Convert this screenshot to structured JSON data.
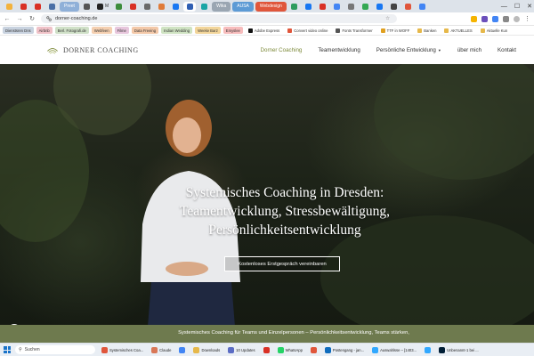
{
  "browser": {
    "tabs": [
      {
        "label": "",
        "color": "#f3b23c"
      },
      {
        "label": "",
        "color": "#d93025"
      },
      {
        "label": "",
        "color": "#d93025"
      },
      {
        "label": "",
        "color": "#4a6fa5"
      },
      {
        "label": "Preet",
        "color": "#8fb0d8",
        "pill": true
      },
      {
        "label": "",
        "color": "#555555"
      },
      {
        "label": "M",
        "color": "#222222"
      },
      {
        "label": "",
        "color": "#3b8c3b"
      },
      {
        "label": "",
        "color": "#d93025"
      },
      {
        "label": "",
        "color": "#6a6a6a"
      },
      {
        "label": "",
        "color": "#e07b39"
      },
      {
        "label": "",
        "color": "#1877f2"
      },
      {
        "label": "",
        "color": "#2f5fb3",
        "active": true
      },
      {
        "label": "",
        "color": "#1aa5a5"
      },
      {
        "label": "Wika",
        "color": "#9aa6b2",
        "pill": true
      },
      {
        "label": "AUSA",
        "color": "#5d9bd5",
        "pill": true
      },
      {
        "label": "Webdesign",
        "color": "#e0563b",
        "pill": true
      },
      {
        "label": "",
        "color": "#2e9c5e"
      },
      {
        "label": "",
        "color": "#1877f2"
      },
      {
        "label": "",
        "color": "#d93025"
      },
      {
        "label": "",
        "color": "#4285f4"
      },
      {
        "label": "",
        "color": "#777777"
      },
      {
        "label": "",
        "color": "#34a853"
      },
      {
        "label": "",
        "color": "#1877f2"
      },
      {
        "label": "",
        "color": "#444444"
      },
      {
        "label": "",
        "color": "#e0563b"
      },
      {
        "label": "",
        "color": "#4285f4"
      }
    ],
    "window_controls": {
      "minimize": "—",
      "maximize": "☐",
      "close": "✕"
    },
    "url": "dorner-coaching.de",
    "bookmarks": [
      {
        "label": "Dienstsren Dns",
        "color": "#c8d2df"
      },
      {
        "label": "Airbnb",
        "color": "#f0c2c8"
      },
      {
        "label": "Berl. Fotografi.de",
        "color": "#cfe0c7"
      },
      {
        "label": "Webfeen",
        "color": "#f4cfb0"
      },
      {
        "label": "Filme",
        "color": "#e7c6dc"
      },
      {
        "label": "Data Freeing",
        "color": "#f3c8a8"
      },
      {
        "label": "Indian Wedding",
        "color": "#cfe3c2"
      },
      {
        "label": "Weeke Barz",
        "color": "#f2d59a"
      },
      {
        "label": "Emyslee",
        "color": "#f7bcbc"
      },
      {
        "label": "Adobe Express",
        "plain": true,
        "color": "#111111"
      },
      {
        "label": "Convert video online",
        "plain": true,
        "color": "#e0563b"
      },
      {
        "label": "Fonts Transformer",
        "plain": true,
        "color": "#555555"
      },
      {
        "label": "TTF in WOFF",
        "plain": true,
        "color": "#e0a020"
      },
      {
        "label": "Banken",
        "plain": true,
        "color": "#e6b84a"
      },
      {
        "label": "AKTUELLES",
        "plain": true,
        "color": "#e6b84a"
      },
      {
        "label": "Aktuelle Kun",
        "plain": true,
        "color": "#e6b84a"
      }
    ]
  },
  "site": {
    "logo_text": "DORNER COACHING",
    "nav": [
      {
        "label": "Dorner Coaching",
        "active": true
      },
      {
        "label": "Teamentwicklung"
      },
      {
        "label": "Persönliche Entwicklung",
        "dropdown": true
      },
      {
        "label": "über mich"
      },
      {
        "label": "Kontakt"
      }
    ],
    "hero": {
      "title_line1": "Systemisches Coaching in Dresden:",
      "title_line2": "Teamentwicklung, Stressbewältigung,",
      "title_line3": "Persönlichkeitsentwicklung",
      "cta_label": "Kostenloses Erstgespräch vereinbaren"
    },
    "tagline": "Systemisches Coaching für Teams und Einzelpersonen – Persönlichkeitsentwicklung, Teams stärken,"
  },
  "taskbar": {
    "search_label": "Suchen",
    "apps": [
      {
        "label": "Systemisches Coa...",
        "color": "#e0563b"
      },
      {
        "label": "Claude",
        "color": "#d97757"
      },
      {
        "label": "",
        "color": "#4285f4"
      },
      {
        "label": "Downloads",
        "color": "#e6b84a"
      },
      {
        "label": "10 Updates",
        "color": "#5b6cc4"
      },
      {
        "label": "",
        "color": "#d93025"
      },
      {
        "label": "WhatsApp",
        "color": "#25d366"
      },
      {
        "label": "",
        "color": "#e0563b"
      },
      {
        "label": "Postengang - jan...",
        "color": "#0f6cbd"
      },
      {
        "label": "Auswahlsse – [1403...",
        "color": "#31a8ff"
      },
      {
        "label": "",
        "color": "#31a8ff"
      },
      {
        "label": "Unbenannt-1 bei ...",
        "color": "#001e36"
      }
    ]
  }
}
